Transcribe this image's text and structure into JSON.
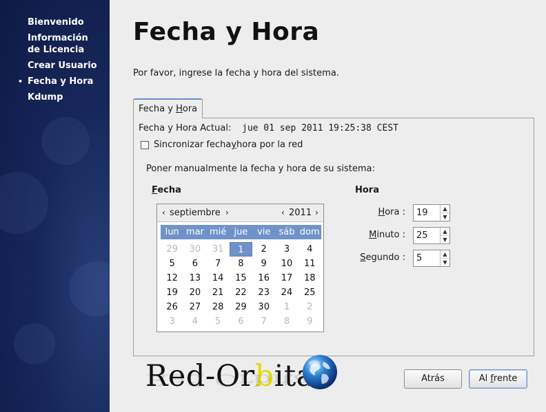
{
  "sidebar": {
    "items": [
      {
        "label": "Bienvenido"
      },
      {
        "label": "Información"
      },
      {
        "label": "de Licencia"
      },
      {
        "label": "Crear Usuario"
      },
      {
        "label": "Fecha y Hora",
        "current": true
      },
      {
        "label": "Kdump"
      }
    ],
    "current_marker": "•"
  },
  "main": {
    "title": "Fecha y Hora",
    "intro": "Por favor, ingrese la fecha y hora del sistema.",
    "tab": {
      "label_pre": "Fecha y ",
      "label_u": "H",
      "label_post": "ora"
    },
    "current_label": "Fecha y Hora Actual:",
    "current_value": "jue 01 sep 2011 19:25:38 CEST",
    "sync": {
      "pre": "Sincronizar fecha ",
      "u": "y",
      "post": " hora por la red",
      "checked": false
    },
    "manual_label": "Poner manualmente la fecha y hora de su sistema:",
    "fecha_section": {
      "u": "F",
      "rest": "echa"
    },
    "hora_section": "Hora"
  },
  "calendar": {
    "prev_month": "‹",
    "month": "septiembre",
    "next_month": "›",
    "prev_year": "‹",
    "year": "2011",
    "next_year": "›",
    "weekdays": [
      "lun",
      "mar",
      "mié",
      "jue",
      "vie",
      "sáb",
      "dom"
    ],
    "weeks": [
      [
        {
          "d": "29",
          "o": true
        },
        {
          "d": "30",
          "o": true
        },
        {
          "d": "31",
          "o": true
        },
        {
          "d": "1",
          "sel": true
        },
        {
          "d": "2"
        },
        {
          "d": "3"
        },
        {
          "d": "4"
        }
      ],
      [
        {
          "d": "5"
        },
        {
          "d": "6"
        },
        {
          "d": "7"
        },
        {
          "d": "8"
        },
        {
          "d": "9"
        },
        {
          "d": "10"
        },
        {
          "d": "11"
        }
      ],
      [
        {
          "d": "12"
        },
        {
          "d": "13"
        },
        {
          "d": "14"
        },
        {
          "d": "15"
        },
        {
          "d": "16"
        },
        {
          "d": "17"
        },
        {
          "d": "18"
        }
      ],
      [
        {
          "d": "19"
        },
        {
          "d": "20"
        },
        {
          "d": "21"
        },
        {
          "d": "22"
        },
        {
          "d": "23"
        },
        {
          "d": "24"
        },
        {
          "d": "25"
        }
      ],
      [
        {
          "d": "26"
        },
        {
          "d": "27"
        },
        {
          "d": "28"
        },
        {
          "d": "29"
        },
        {
          "d": "30"
        },
        {
          "d": "1",
          "o": true
        },
        {
          "d": "2",
          "o": true
        }
      ],
      [
        {
          "d": "3",
          "o": true
        },
        {
          "d": "4",
          "o": true
        },
        {
          "d": "5",
          "o": true
        },
        {
          "d": "6",
          "o": true
        },
        {
          "d": "7",
          "o": true
        },
        {
          "d": "8",
          "o": true
        },
        {
          "d": "9",
          "o": true
        }
      ]
    ]
  },
  "time": {
    "hora": {
      "u": "H",
      "rest": "ora :",
      "value": "19"
    },
    "minuto": {
      "u": "M",
      "rest": "inuto :",
      "value": "25"
    },
    "segundo": {
      "u": "S",
      "rest": "egundo :",
      "value": "5"
    }
  },
  "logo": {
    "pre": "Red-Or",
    "yellow": "b",
    "post": "ita"
  },
  "buttons": {
    "back": "Atrás",
    "forward_pre": "Al ",
    "forward_u": "f",
    "forward_post": "rente"
  },
  "colors": {
    "sidebar_bg": "#16275a",
    "calendar_header": "#6f93c9",
    "selected_day": "#6f93c9",
    "logo_accent": "#e6d800"
  },
  "icons": {
    "spin_up": "▲",
    "spin_down": "▼",
    "globe": "globe-icon"
  }
}
